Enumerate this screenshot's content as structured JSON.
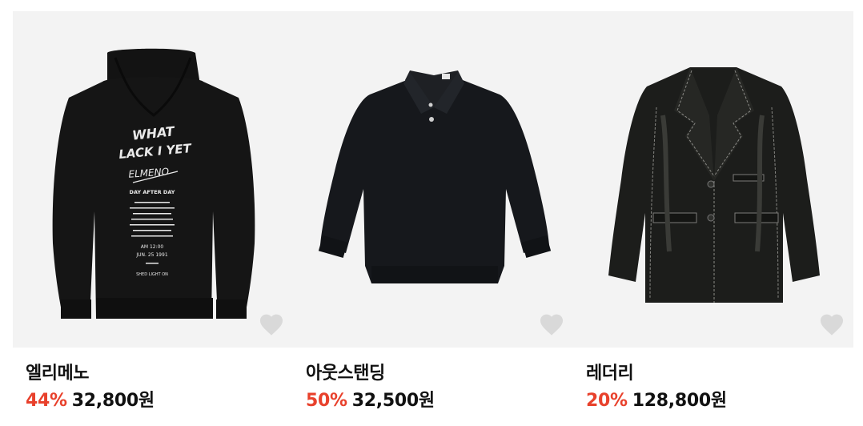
{
  "products": [
    {
      "brand": "엘리메노",
      "discount": "44%",
      "price": "32,800원",
      "print_text": [
        "WHAT",
        "LACK I YET",
        "ELMENO",
        "DAY AFTER DAY",
        "AM 12:00",
        "JUN. 25 1991",
        "SHED LIGHT ON"
      ],
      "icons": {
        "favorite": "heart-icon"
      }
    },
    {
      "brand": "아웃스탠딩",
      "discount": "50%",
      "price": "32,500원",
      "icons": {
        "favorite": "heart-icon"
      }
    },
    {
      "brand": "레더리",
      "discount": "20%",
      "price": "128,800원",
      "icons": {
        "favorite": "heart-icon"
      }
    }
  ],
  "colors": {
    "discount": "#e8412c",
    "image_bg": "#f3f3f3",
    "heart": "#d9d9d9"
  }
}
